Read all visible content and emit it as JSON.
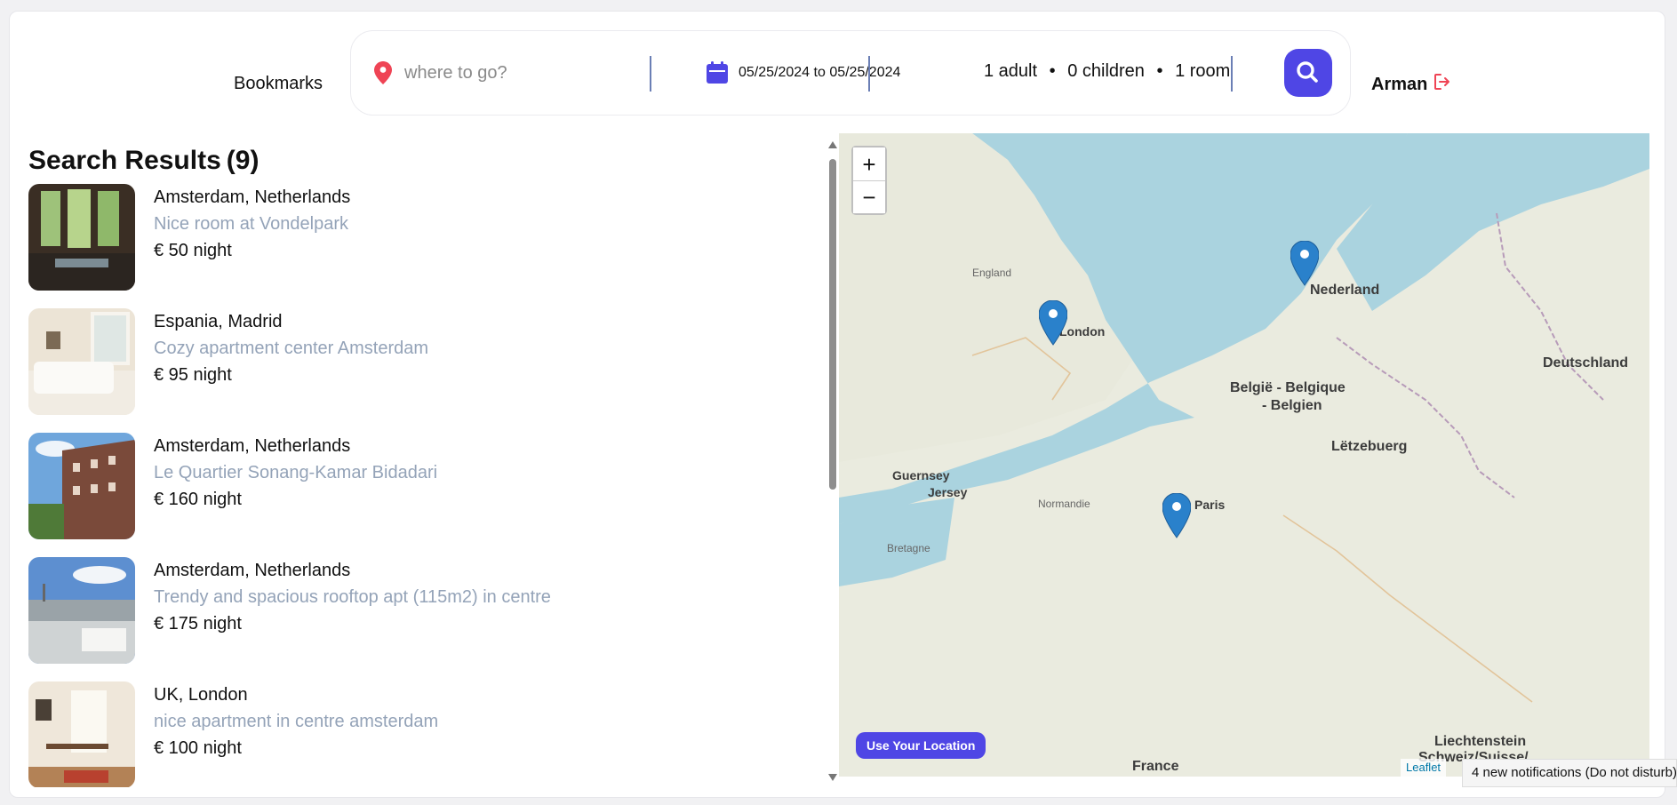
{
  "header": {
    "bookmarks_label": "Bookmarks",
    "destination_placeholder": "where to go?",
    "date_range": "05/25/2024 to 05/25/2024",
    "guests": {
      "adults": "1 adult",
      "children": "0 children",
      "rooms": "1 room",
      "separator": "•"
    },
    "user_name": "Arman",
    "search_icon": "search-icon",
    "logout_icon": "logout-icon"
  },
  "results": {
    "title": "Search Results",
    "count": "(9)",
    "items": [
      {
        "location": "Amsterdam, Netherlands",
        "name": "Nice room at Vondelpark",
        "price": "€ 50 night"
      },
      {
        "location": "Espania, Madrid",
        "name": "Cozy apartment center Amsterdam",
        "price": "€ 95 night"
      },
      {
        "location": "Amsterdam, Netherlands",
        "name": "Le Quartier Sonang-Kamar Bidadari",
        "price": "€ 160 night"
      },
      {
        "location": "Amsterdam, Netherlands",
        "name": "Trendy and spacious rooftop apt (115m2) in centre",
        "price": "€ 175 night"
      },
      {
        "location": "UK, London",
        "name": "nice apartment in centre amsterdam",
        "price": "€ 100 night"
      }
    ]
  },
  "map": {
    "zoom_in": "+",
    "zoom_out": "−",
    "use_location": "Use Your Location",
    "attribution": "Leaflet",
    "labels": {
      "london": "London",
      "nederland": "Nederland",
      "belgie": "België - Belgique",
      "belgien": "- Belgien",
      "deutschland": "Deutschland",
      "letzebuerg": "Lëtzebuerg",
      "paris": "Paris",
      "france": "France",
      "guernsey": "Guernsey",
      "jersey": "Jersey",
      "liechtenstein": "Liechtenstein",
      "schweiz": "Schweiz/Suisse/",
      "england": "England",
      "normandie": "Normandie",
      "bretagne": "Bretagne"
    }
  },
  "notification": "4 new notifications (Do not disturb)",
  "colors": {
    "accent": "#4f46e5",
    "pin": "#ef4455",
    "subtitle": "#94a3b8",
    "marker": "#2a81cb",
    "sea": "#aad3df"
  }
}
